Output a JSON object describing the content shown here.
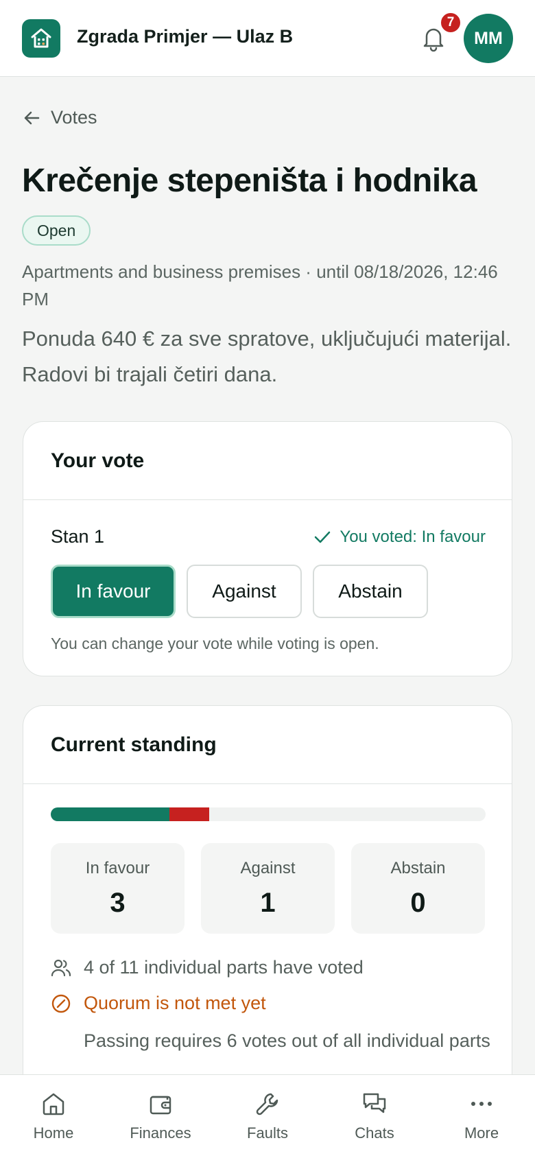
{
  "header": {
    "title": "Zgrada Primjer — Ulaz B",
    "notification_count": "7",
    "avatar_initials": "MM"
  },
  "back_link": {
    "label": "Votes"
  },
  "vote": {
    "title": "Krečenje stepeništa i hodnika",
    "status": "Open",
    "meta": "Apartments and business premises · until 08/18/2026, 12:46 PM",
    "description": "Ponuda 640 € za sve spratove, uključujući materijal. Radovi bi trajali četiri dana."
  },
  "your_vote": {
    "heading": "Your vote",
    "unit": "Stan 1",
    "voted_text": "You voted: In favour",
    "options": [
      {
        "label": "In favour",
        "selected": true
      },
      {
        "label": "Against",
        "selected": false
      },
      {
        "label": "Abstain",
        "selected": false
      }
    ],
    "hint": "You can change your vote while voting is open."
  },
  "standing": {
    "heading": "Current standing",
    "in_favour_label": "In favour",
    "in_favour_value": 3,
    "against_label": "Against",
    "against_value": 1,
    "abstain_label": "Abstain",
    "abstain_value": 0,
    "total_parts": 11,
    "voted_text": "4 of 11 individual parts have voted",
    "quorum_text": "Quorum is not met yet",
    "passing_text": "Passing requires 6 votes out of all individual parts"
  },
  "colors": {
    "accent": "#127a62",
    "against": "#c6211f",
    "warning": "#c2570c"
  },
  "nav": {
    "items": [
      {
        "label": "Home",
        "icon": "home-icon"
      },
      {
        "label": "Finances",
        "icon": "wallet-icon"
      },
      {
        "label": "Faults",
        "icon": "wrench-icon"
      },
      {
        "label": "Chats",
        "icon": "chat-icon"
      },
      {
        "label": "More",
        "icon": "more-icon"
      }
    ]
  }
}
